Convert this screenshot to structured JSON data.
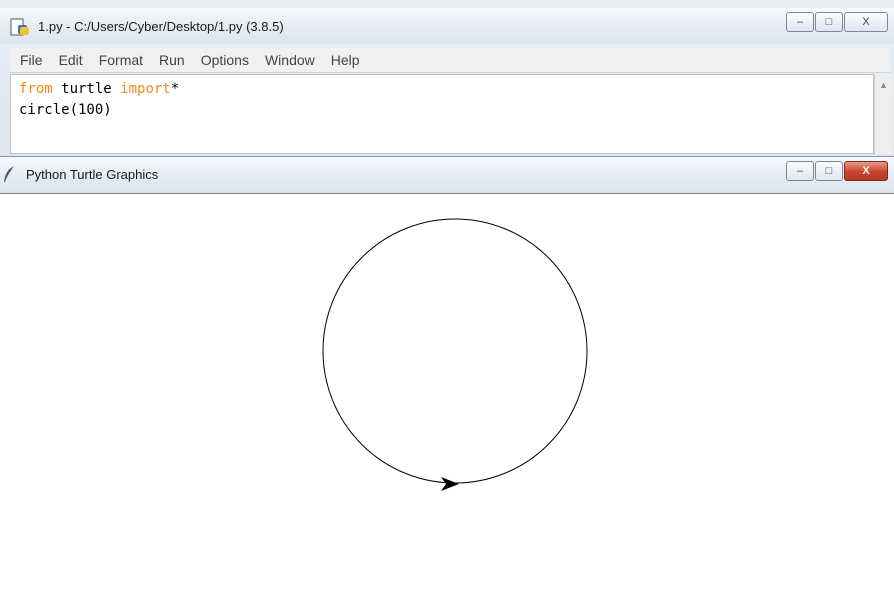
{
  "editor_window": {
    "title": "1.py - C:/Users/Cyber/Desktop/1.py (3.8.5)",
    "icon": "python-file-icon",
    "menu": [
      "File",
      "Edit",
      "Format",
      "Run",
      "Options",
      "Window",
      "Help"
    ],
    "code": {
      "line1": {
        "kw1": "from",
        "text1": " turtle ",
        "kw2": "import",
        "text2": "*"
      },
      "line2": "circle(100)"
    },
    "window_buttons": {
      "minimize": "–",
      "maximize": "□",
      "close": "X"
    }
  },
  "turtle_window": {
    "title": "Python Turtle Graphics",
    "icon": "feather-icon",
    "window_buttons": {
      "minimize": "–",
      "maximize": "□",
      "close": "X"
    },
    "drawing": {
      "shape": "circle",
      "radius": 100,
      "pen_color": "#000000",
      "turtle_shape": "classic-arrow"
    }
  },
  "colors": {
    "keyword": "#f28a1b",
    "close_button": "#c9442c"
  }
}
